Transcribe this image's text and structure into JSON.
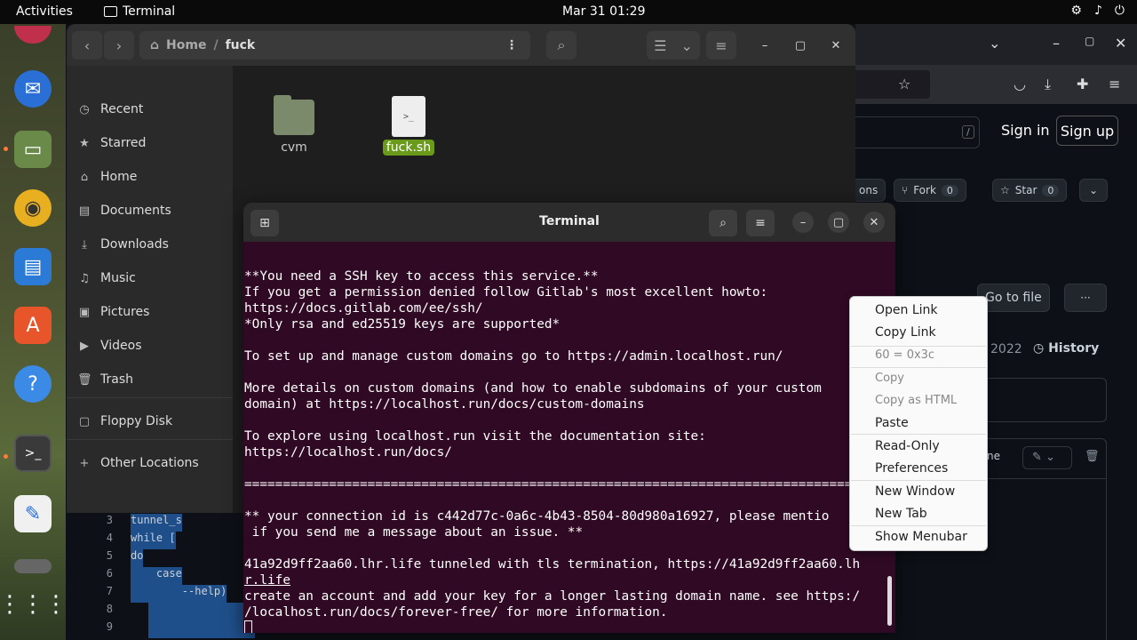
{
  "topbar": {
    "activities": "Activities",
    "app_name": "Terminal",
    "clock": "Mar 31  01:29",
    "tray": [
      "⚙",
      "♪",
      "⏻"
    ]
  },
  "files": {
    "path": {
      "home": "Home",
      "separator": "/",
      "folder": "fuck"
    },
    "sidebar": [
      {
        "icon": "◷",
        "label": "Recent"
      },
      {
        "icon": "★",
        "label": "Starred"
      },
      {
        "icon": "⌂",
        "label": "Home"
      },
      {
        "icon": "▤",
        "label": "Documents"
      },
      {
        "icon": "⤓",
        "label": "Downloads"
      },
      {
        "icon": "♫",
        "label": "Music"
      },
      {
        "icon": "▣",
        "label": "Pictures"
      },
      {
        "icon": "▶",
        "label": "Videos"
      },
      {
        "icon": "🗑",
        "label": "Trash"
      },
      {
        "icon": "▢",
        "label": "Floppy Disk"
      },
      {
        "icon": "+",
        "label": "Other Locations"
      }
    ],
    "items": [
      {
        "label": "cvm",
        "type": "folder"
      },
      {
        "label": "fuck.sh",
        "type": "script"
      }
    ]
  },
  "terminal": {
    "title": "Terminal",
    "lines": [
      "**You need a SSH key to access this service.**",
      "If you get a permission denied follow Gitlab's most excellent howto:",
      "https://docs.gitlab.com/ee/ssh/",
      "*Only rsa and ed25519 keys are supported*",
      "",
      "To set up and manage custom domains go to https://admin.localhost.run/",
      "",
      "More details on custom domains (and how to enable subdomains of your custom",
      "domain) at https://localhost.run/docs/custom-domains",
      "",
      "To explore using localhost.run visit the documentation site:",
      "https://localhost.run/docs/",
      "",
      "===============================================================================",
      "",
      "** your connection id is c442d77c-0a6c-4b43-8504-80d980a16927, please mentio",
      " if you send me a message about an issue. **",
      "",
      "41a92d9ff2aa60.lhr.life tunneled with tls termination, https://41a92d9ff2aa60.lh",
      "r.life",
      "create an account and add your key for a longer lasting domain name. see https:/",
      "/localhost.run/docs/forever-free/ for more information."
    ]
  },
  "context_menu": {
    "items": [
      "Open Link",
      "Copy Link",
      "60 = 0x3c",
      "Copy",
      "Copy as HTML",
      "Paste",
      "Read-Only",
      "Preferences",
      "New Window",
      "New Tab",
      "Show Menubar"
    ]
  },
  "browser": {
    "sign_in": "Sign in",
    "sign_up": "Sign up",
    "slash": "/",
    "partial_tab": "ons",
    "fork": "Fork",
    "fork_count": "0",
    "star": "Star",
    "star_count": "0",
    "go_to_file": "Go to file",
    "more": "···",
    "year": "2022",
    "history": "History",
    "partial_btn": "ne"
  },
  "code": [
    {
      "n": "3",
      "t": "tunnel_s"
    },
    {
      "n": "4",
      "t": "while ["
    },
    {
      "n": "5",
      "t": "do"
    },
    {
      "n": "6",
      "t": "    case"
    },
    {
      "n": "7",
      "t": "        --help)"
    },
    {
      "n": "8",
      "t": ""
    },
    {
      "n": "9",
      "t": ""
    }
  ]
}
